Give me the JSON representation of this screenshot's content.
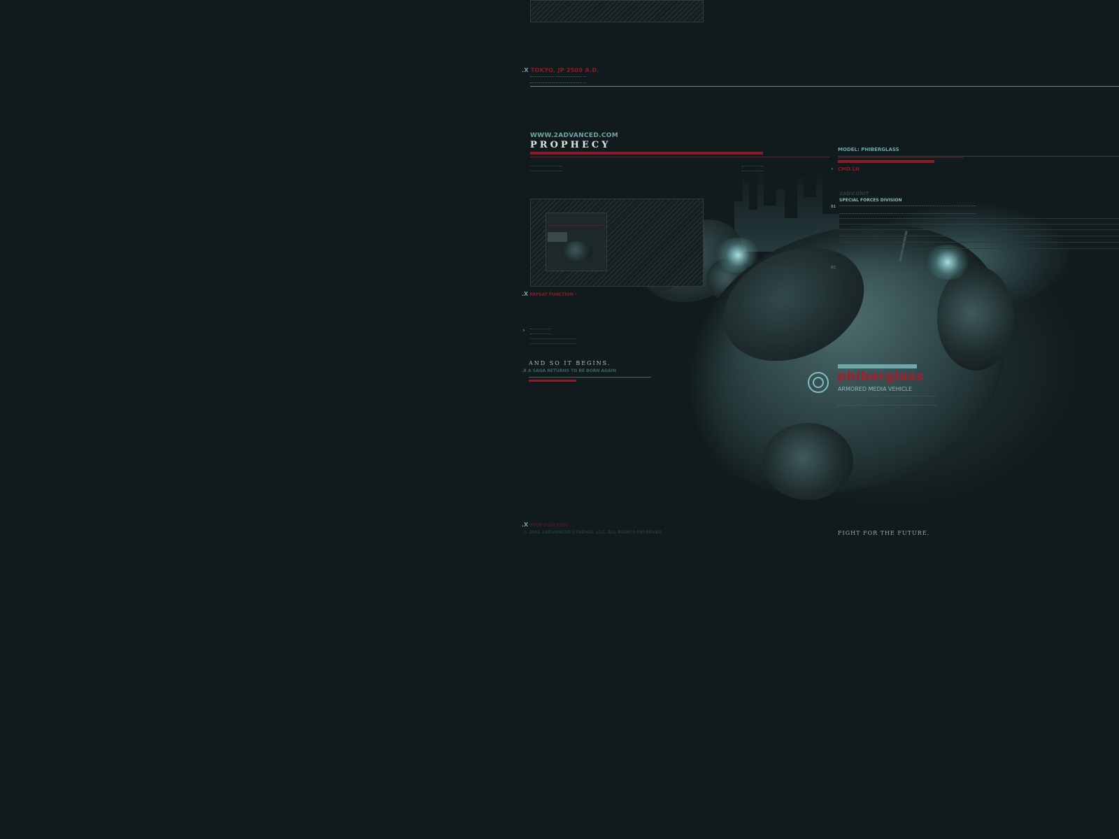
{
  "header": {
    "marker": ".X",
    "location": "TOKYO, JP 2509 A.D."
  },
  "brand": {
    "url": "WWW.2ADVANCED.COM",
    "title": "PROPHECY"
  },
  "nav": {
    "repeat_marker": ".X",
    "repeat_label": "REPEAT FUNCTION",
    "repeat_arrow": "›",
    "side_arrow": "›"
  },
  "intro": {
    "headline": "AND SO IT BEGINS.",
    "sub_marker": ".X",
    "subhead": "A SAGA RETURNS TO BE BORN AGAIN"
  },
  "model_panel": {
    "model_label": "MODEL: PHIBERGLASS",
    "cmd_arrow": "›",
    "cmd_label": "CMD.LN",
    "unit_label": "2ADV.UNIT",
    "division": "SPECIAL FORCES DIVISION",
    "index_01": "01",
    "index_02": "02"
  },
  "product": {
    "name": "phiberglass",
    "tagline": "ARMORED MEDIA VEHICLE"
  },
  "footer": {
    "marker": ".X",
    "stop_label": "STOP FUNCTION",
    "copyright": "© 2002 2ADVANCED STUDIOS, LLC. ALL RIGHTS RESERVED.",
    "slogan": "FIGHT FOR THE FUTURE."
  },
  "colors": {
    "background": "#111a1c",
    "accent_teal": "#6ea7a6",
    "accent_red": "#8e1b25"
  }
}
